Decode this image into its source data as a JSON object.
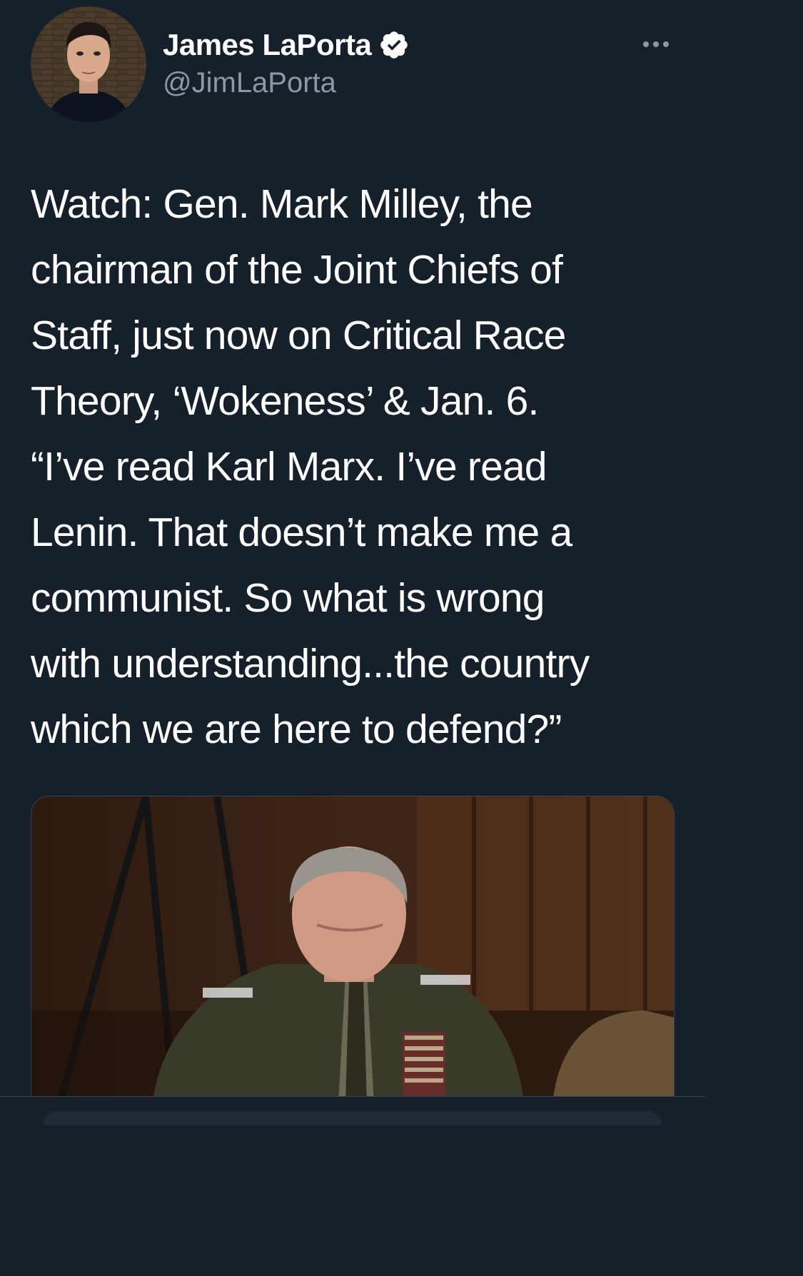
{
  "tweet": {
    "author": {
      "display_name": "James LaPorta",
      "handle": "@JimLaPorta",
      "verified": true,
      "avatar_icon": "profile-photo"
    },
    "more_icon": "more-horizontal-icon",
    "text": "Watch: Gen. Mark Milley, the\nchairman of the Joint Chiefs of\nStaff, just now on Critical Race\nTheory, ‘Wokeness’ & Jan. 6.\n“I’ve read Karl Marx. I’ve read\nLenin. That doesn’t make me a\ncommunist. So what is wrong\nwith understanding...the country\nwhich we are here to defend?”",
    "media": {
      "type": "video-thumbnail"
    }
  },
  "colors": {
    "background": "#15202b",
    "text": "#ffffff",
    "secondary_text": "#8b98a5",
    "border": "#38444d"
  }
}
